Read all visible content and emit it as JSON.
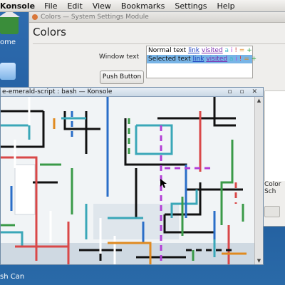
{
  "panel": {
    "app_name": "Konsole",
    "menu": [
      "File",
      "Edit",
      "View",
      "Bookmarks",
      "Settings",
      "Help"
    ]
  },
  "desktop": {
    "home_label": "ome",
    "trash_label": "sh Can"
  },
  "settings_window": {
    "title": "Colors — System Settings Module",
    "heading": "Colors",
    "window_text_label": "Window text",
    "push_button_label": "Push Button",
    "preview": {
      "normal_text": "Normal text",
      "selected_text": "Selected text",
      "link": "link",
      "visited": "visited",
      "a": "a",
      "i": "i",
      "ex": "!",
      "eq": "=",
      "pl": "+"
    },
    "color_scheme_partial": "Color Sch"
  },
  "konsole_window": {
    "title": "e-emerald-script : bash — Konsole",
    "window_buttons": "▫ ▫ ✕"
  },
  "colors": {
    "accent_blue": "#2d6aa8",
    "selection": "#78b4e6"
  }
}
